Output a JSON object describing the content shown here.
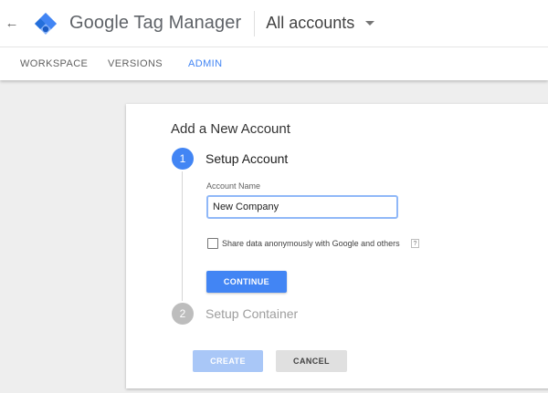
{
  "header": {
    "back_icon": "arrow-left-icon",
    "logo_icon": "tag-manager-logo",
    "product_name": "Google Tag Manager",
    "account_picker": {
      "label": "All accounts",
      "icon": "caret-down-icon"
    }
  },
  "tabs": [
    {
      "label": "WORKSPACE",
      "active": false
    },
    {
      "label": "VERSIONS",
      "active": false
    },
    {
      "label": "ADMIN",
      "active": true
    }
  ],
  "card": {
    "title": "Add a New Account",
    "steps": [
      {
        "number": "1",
        "title": "Setup Account",
        "active": true
      },
      {
        "number": "2",
        "title": "Setup Container",
        "active": false
      }
    ],
    "account_name": {
      "label": "Account Name",
      "value": "New Company"
    },
    "share_data": {
      "label": "Share data anonymously with Google and others",
      "checked": false,
      "help_label": "?"
    },
    "continue_label": "CONTINUE",
    "create_label": "CREATE",
    "cancel_label": "CANCEL"
  },
  "colors": {
    "accent": "#4285f4",
    "disabled_accent": "#a9c7f7",
    "inactive_step": "#bdbdbd"
  }
}
